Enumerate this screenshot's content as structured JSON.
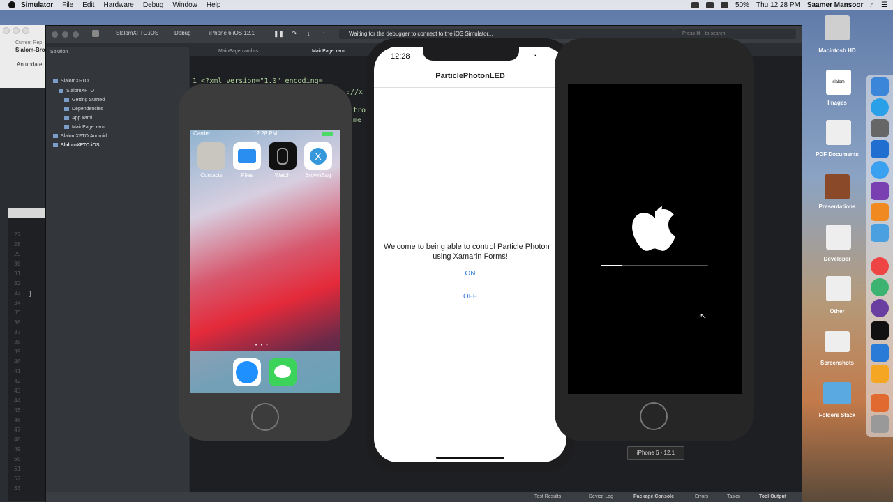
{
  "menubar": {
    "app": "Simulator",
    "items": [
      "File",
      "Edit",
      "Hardware",
      "Debug",
      "Window",
      "Help"
    ],
    "battery": "50%",
    "clock": "Thu 12:28 PM",
    "user": "Saamer Mansoor"
  },
  "left_window": {
    "current_label": "Current Rep",
    "project": "Slalom-Bro",
    "update_text": "An update",
    "line_numbers": [
      "27",
      "28",
      "29",
      "30",
      "31",
      "32",
      "33",
      "34",
      "35",
      "36",
      "37",
      "38",
      "39",
      "40",
      "41",
      "42",
      "43",
      "44",
      "45",
      "46",
      "47",
      "48",
      "49",
      "50",
      "51",
      "52",
      "53"
    ],
    "brace": "}"
  },
  "ide": {
    "breadcrumb": [
      "SlalomXFTO.iOS",
      "Debug",
      "iPhone 6 iOS 12.1"
    ],
    "status": "Waiting for the debugger to connect to the iOS Simulator...",
    "search_placeholder": "Press ⌘ . to search",
    "solution_header": "Solution",
    "tree": [
      {
        "label": "SlalomXFTO"
      },
      {
        "label": "SlalomXFTO"
      },
      {
        "label": "Getting Started"
      },
      {
        "label": "Dependencies"
      },
      {
        "label": "App.xaml"
      },
      {
        "label": "MainPage.xaml"
      },
      {
        "label": "SlalomXFTO.Android"
      },
      {
        "label": "SlalomXFTO.iOS"
      }
    ],
    "tabs": [
      "MainPage.xaml.cs",
      "MainPage.xaml"
    ],
    "code_lines": [
      "1  <?xml version=\"1.0\" encoding=",
      "://x",
      "tro",
      "me"
    ],
    "bottom_items": [
      "Test Results",
      "Device Log",
      "Package Console",
      "Errors",
      "Tasks",
      "Tool Output"
    ]
  },
  "phone_home": {
    "carrier": "Carrier",
    "time": "12:28 PM",
    "apps": [
      "Contacts",
      "Files",
      "Watch",
      "BrownBag"
    ]
  },
  "phone_app": {
    "time": "12:28",
    "nav_title": "ParticlePhotonLED",
    "welcome_line1": "Welcome to being able to control Particle Photon",
    "welcome_line2": "using Xamarin Forms!",
    "on_button": "ON",
    "off_button": "OFF"
  },
  "phone_boot": {
    "boot_progress": 0.2,
    "device_label": "iPhone 6 - 12.1"
  },
  "desktop": {
    "items": [
      "Macintosh HD",
      "Images",
      "PDF Documents",
      "Presentations",
      "Developer",
      "Other",
      "Screenshots",
      "Folders Stack"
    ],
    "images_badge": "slalom"
  },
  "colors": {
    "ios_blue": "#2f7bd6",
    "ide_bg": "#2b2e33"
  }
}
